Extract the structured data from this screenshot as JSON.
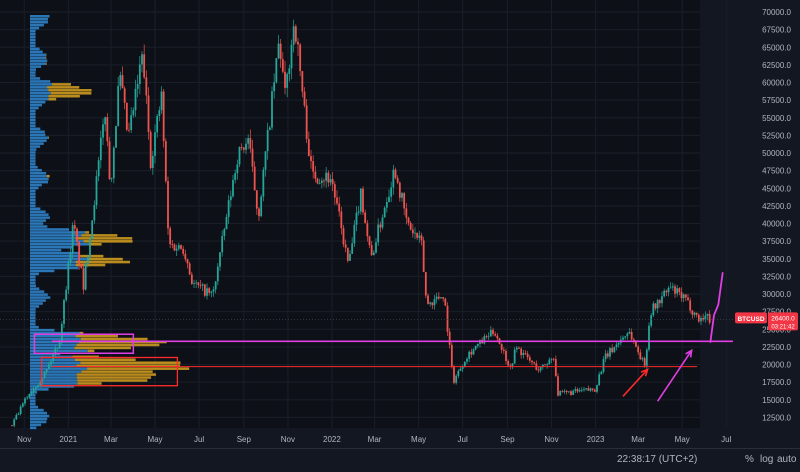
{
  "status_bar": {
    "clock": "22:38:17 (UTC+2)",
    "percent_label": "%",
    "log_label": "log",
    "auto_label": "auto"
  },
  "colors": {
    "background": "#131722",
    "up_candle": "#26a69a",
    "down_candle": "#ef5350",
    "volume_profile_blue": "#2f82c9",
    "volume_profile_orange": "#d9a21f",
    "magenta_annotation": "#e23ee5",
    "red_annotation": "#ff2a2a",
    "price_tag": "#f23645"
  },
  "chart_data": {
    "type": "candlestick",
    "symbol": "BTCUSD",
    "last_price": "26400.0",
    "countdown": "03:21:42",
    "x_axis": {
      "range": [
        "2020-10-15",
        "2023-07-20"
      ],
      "ticks": [
        {
          "date": "2020-11-01",
          "label": "Nov"
        },
        {
          "date": "2021-01-01",
          "label": "2021"
        },
        {
          "date": "2021-03-01",
          "label": "Mar"
        },
        {
          "date": "2021-05-01",
          "label": "May"
        },
        {
          "date": "2021-07-01",
          "label": "Jul"
        },
        {
          "date": "2021-09-01",
          "label": "Sep"
        },
        {
          "date": "2021-11-01",
          "label": "Nov"
        },
        {
          "date": "2022-01-01",
          "label": "2022"
        },
        {
          "date": "2022-03-01",
          "label": "Mar"
        },
        {
          "date": "2022-05-01",
          "label": "May"
        },
        {
          "date": "2022-07-01",
          "label": "Jul"
        },
        {
          "date": "2022-09-01",
          "label": "Sep"
        },
        {
          "date": "2022-11-01",
          "label": "Nov"
        },
        {
          "date": "2023-01-01",
          "label": "2023"
        },
        {
          "date": "2023-03-01",
          "label": "Mar"
        },
        {
          "date": "2023-05-01",
          "label": "May"
        },
        {
          "date": "2023-07-01",
          "label": "Jul"
        }
      ]
    },
    "y_axis": {
      "range": [
        11000,
        71000
      ],
      "ticks": [
        "12500.0",
        "15000.0",
        "17500.0",
        "20000.0",
        "22500.0",
        "25000.0",
        "27500.0",
        "30000.0",
        "32500.0",
        "35000.0",
        "37500.0",
        "40000.0",
        "42500.0",
        "45000.0",
        "47500.0",
        "50000.0",
        "52500.0",
        "55000.0",
        "57500.0",
        "60000.0",
        "62500.0",
        "65000.0",
        "67500.0",
        "70000.0"
      ]
    },
    "price_path": [
      {
        "date": "2020-10-15",
        "price": 11400
      },
      {
        "date": "2020-11-05",
        "price": 15500
      },
      {
        "date": "2020-12-01",
        "price": 19000
      },
      {
        "date": "2020-12-20",
        "price": 23500
      },
      {
        "date": "2021-01-08",
        "price": 40000
      },
      {
        "date": "2021-01-22",
        "price": 31000
      },
      {
        "date": "2021-02-21",
        "price": 56000
      },
      {
        "date": "2021-02-28",
        "price": 45000
      },
      {
        "date": "2021-03-13",
        "price": 61000
      },
      {
        "date": "2021-03-25",
        "price": 52000
      },
      {
        "date": "2021-04-14",
        "price": 64000
      },
      {
        "date": "2021-04-25",
        "price": 49000
      },
      {
        "date": "2021-05-10",
        "price": 58000
      },
      {
        "date": "2021-05-20",
        "price": 37000
      },
      {
        "date": "2021-06-10",
        "price": 36500
      },
      {
        "date": "2021-06-22",
        "price": 31500
      },
      {
        "date": "2021-07-20",
        "price": 29800
      },
      {
        "date": "2021-08-23",
        "price": 49500
      },
      {
        "date": "2021-09-07",
        "price": 52000
      },
      {
        "date": "2021-09-21",
        "price": 41000
      },
      {
        "date": "2021-10-20",
        "price": 66000
      },
      {
        "date": "2021-10-28",
        "price": 58000
      },
      {
        "date": "2021-11-10",
        "price": 69000
      },
      {
        "date": "2021-11-26",
        "price": 54000
      },
      {
        "date": "2021-12-04",
        "price": 47000
      },
      {
        "date": "2021-12-31",
        "price": 46500
      },
      {
        "date": "2022-01-24",
        "price": 34000
      },
      {
        "date": "2022-02-10",
        "price": 44500
      },
      {
        "date": "2022-02-24",
        "price": 35000
      },
      {
        "date": "2022-03-29",
        "price": 48000
      },
      {
        "date": "2022-04-15",
        "price": 40000
      },
      {
        "date": "2022-05-05",
        "price": 37000
      },
      {
        "date": "2022-05-12",
        "price": 28500
      },
      {
        "date": "2022-06-05",
        "price": 30000
      },
      {
        "date": "2022-06-18",
        "price": 17600
      },
      {
        "date": "2022-07-08",
        "price": 21500
      },
      {
        "date": "2022-08-14",
        "price": 24800
      },
      {
        "date": "2022-09-05",
        "price": 19500
      },
      {
        "date": "2022-09-13",
        "price": 22500
      },
      {
        "date": "2022-10-15",
        "price": 19200
      },
      {
        "date": "2022-11-05",
        "price": 21300
      },
      {
        "date": "2022-11-09",
        "price": 15800
      },
      {
        "date": "2022-12-31",
        "price": 16500
      },
      {
        "date": "2023-01-14",
        "price": 21000
      },
      {
        "date": "2023-02-16",
        "price": 24800
      },
      {
        "date": "2023-03-10",
        "price": 19800
      },
      {
        "date": "2023-03-18",
        "price": 27500
      },
      {
        "date": "2023-04-14",
        "price": 30900
      },
      {
        "date": "2023-05-05",
        "price": 29200
      },
      {
        "date": "2023-05-25",
        "price": 26300
      },
      {
        "date": "2023-06-01",
        "price": 27000
      },
      {
        "date": "2023-06-09",
        "price": 26400
      }
    ],
    "volume_profile": {
      "blue_extends_to_price": 44000,
      "peaks": [
        {
          "price": 59000,
          "strength": 0.38
        },
        {
          "price": 38000,
          "strength": 0.65
        },
        {
          "price": 35000,
          "strength": 0.58
        },
        {
          "price": 23300,
          "strength": 0.85
        },
        {
          "price": 20000,
          "strength": 1.0
        },
        {
          "price": 18500,
          "strength": 0.8
        }
      ]
    },
    "annotations": {
      "magenta_horizontal_price": 23300,
      "red_horizontal_price": 19700,
      "magenta_box": {
        "date_start": "2020-11-15",
        "date_end": "2021-04-01",
        "price_high": 24300,
        "price_low": 21600
      },
      "red_box": {
        "date_start": "2020-11-25",
        "date_end": "2021-06-01",
        "price_high": 21000,
        "price_low": 17000
      },
      "projection_path": [
        {
          "date": "2023-06-09",
          "price": 23200
        },
        {
          "date": "2023-06-14",
          "price": 27000
        },
        {
          "date": "2023-06-20",
          "price": 28500
        },
        {
          "date": "2023-06-26",
          "price": 33000
        }
      ],
      "red_arrow": {
        "from": {
          "date": "2023-02-08",
          "price": 15500
        },
        "to": {
          "date": "2023-03-14",
          "price": 19300
        }
      },
      "magenta_arrow": {
        "from": {
          "date": "2023-03-28",
          "price": 14800
        },
        "to": {
          "date": "2023-05-14",
          "price": 22000
        }
      }
    }
  }
}
